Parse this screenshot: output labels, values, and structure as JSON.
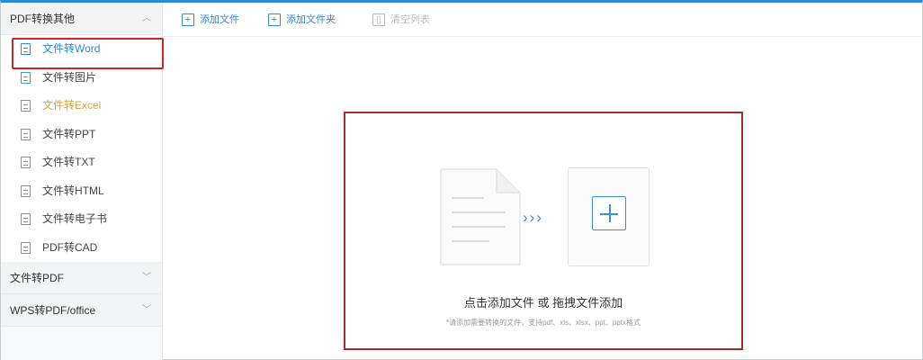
{
  "sidebar": {
    "sections": [
      {
        "label": "PDF转换其他",
        "expanded": true,
        "items": [
          {
            "label": "文件转Word",
            "icon": "word-doc-icon",
            "selected": true
          },
          {
            "label": "文件转图片",
            "icon": "image-doc-icon"
          },
          {
            "label": "文件转Excel",
            "icon": "excel-doc-icon"
          },
          {
            "label": "文件转PPT",
            "icon": "ppt-doc-icon"
          },
          {
            "label": "文件转TXT",
            "icon": "txt-doc-icon"
          },
          {
            "label": "文件转HTML",
            "icon": "html-doc-icon"
          },
          {
            "label": "文件转电子书",
            "icon": "ebook-doc-icon"
          },
          {
            "label": "PDF转CAD",
            "icon": "cad-doc-icon"
          }
        ]
      },
      {
        "label": "文件转PDF",
        "expanded": false
      },
      {
        "label": "WPS转PDF/office",
        "expanded": false
      }
    ]
  },
  "toolbar": {
    "add_file": "添加文件",
    "add_folder": "添加文件夹",
    "clear_list": "清空列表",
    "clear_list_disabled": true
  },
  "dropzone": {
    "title": "点击添加文件 或 拖拽文件添加",
    "hint": "*请添加需要转换的文件，支持pdf、xls、xlsx、ppt、pptx格式",
    "arrows": "›››"
  },
  "colors": {
    "accent": "#2f87d8",
    "highlight_border": "#c62828",
    "excel_label": "#d9a440"
  }
}
